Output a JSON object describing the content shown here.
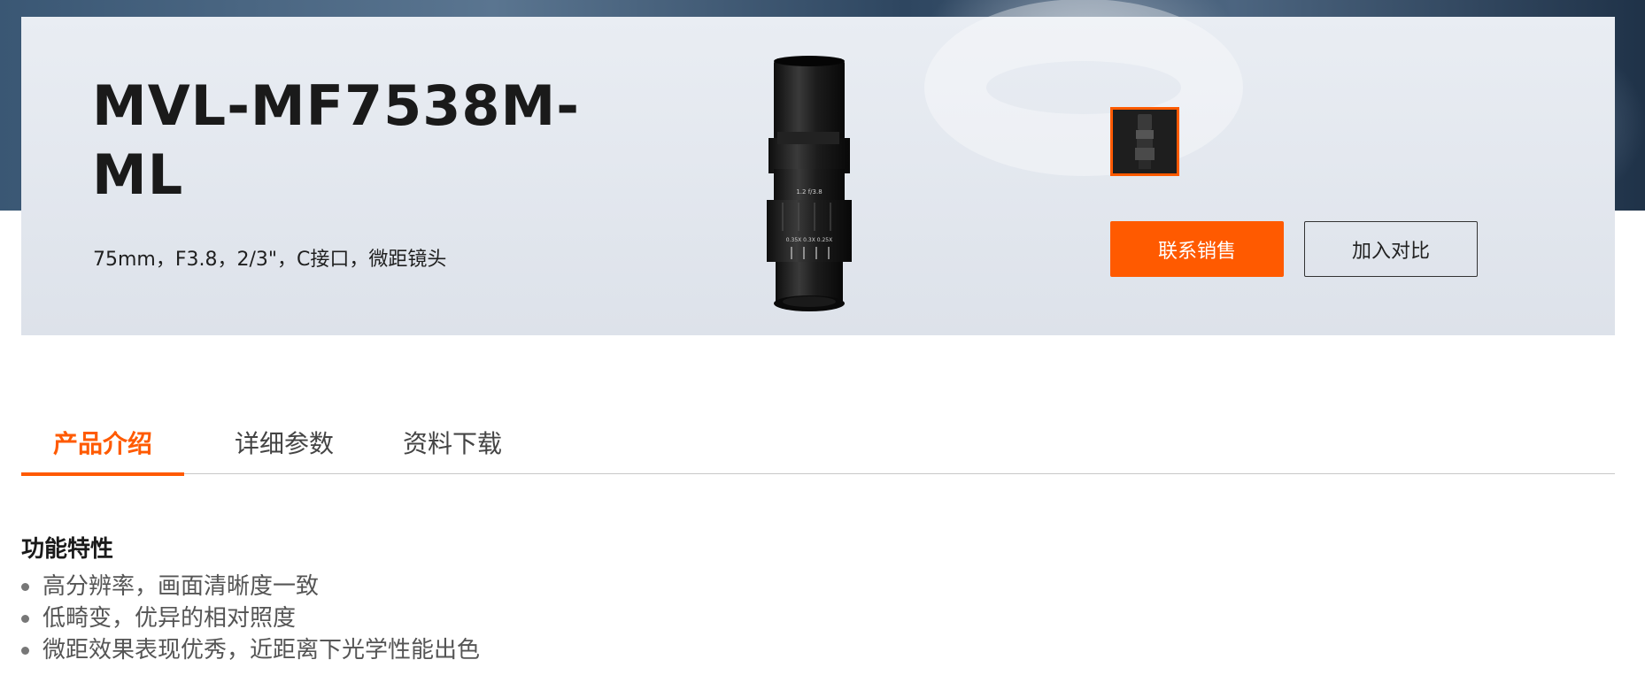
{
  "product": {
    "title": "MVL-MF7538M-ML",
    "subtitle": "75mm，F3.8，2/3\"，C接口，微距镜头"
  },
  "actions": {
    "contact_label": "联系销售",
    "compare_label": "加入对比"
  },
  "tabs": [
    {
      "label": "产品介绍",
      "active": true
    },
    {
      "label": "详细参数",
      "active": false
    },
    {
      "label": "资料下载",
      "active": false
    }
  ],
  "features": {
    "heading": "功能特性",
    "items": [
      "高分辨率，画面清晰度一致",
      "低畸变，优异的相对照度",
      "微距效果表现优秀，近距离下光学性能出色"
    ]
  },
  "lens_markings": {
    "focal": "75mm",
    "aperture": "F3.8",
    "scale": "0.35X 0.3X 0.25X",
    "f_marks": "1.2  f/3.8"
  },
  "colors": {
    "accent": "#ff5a00",
    "card_bg": "#e4e8ee",
    "text": "#1a1a1a"
  },
  "icons": {
    "thumbnail": "lens-thumbnail-icon",
    "bullet": "bullet-dot-icon"
  }
}
